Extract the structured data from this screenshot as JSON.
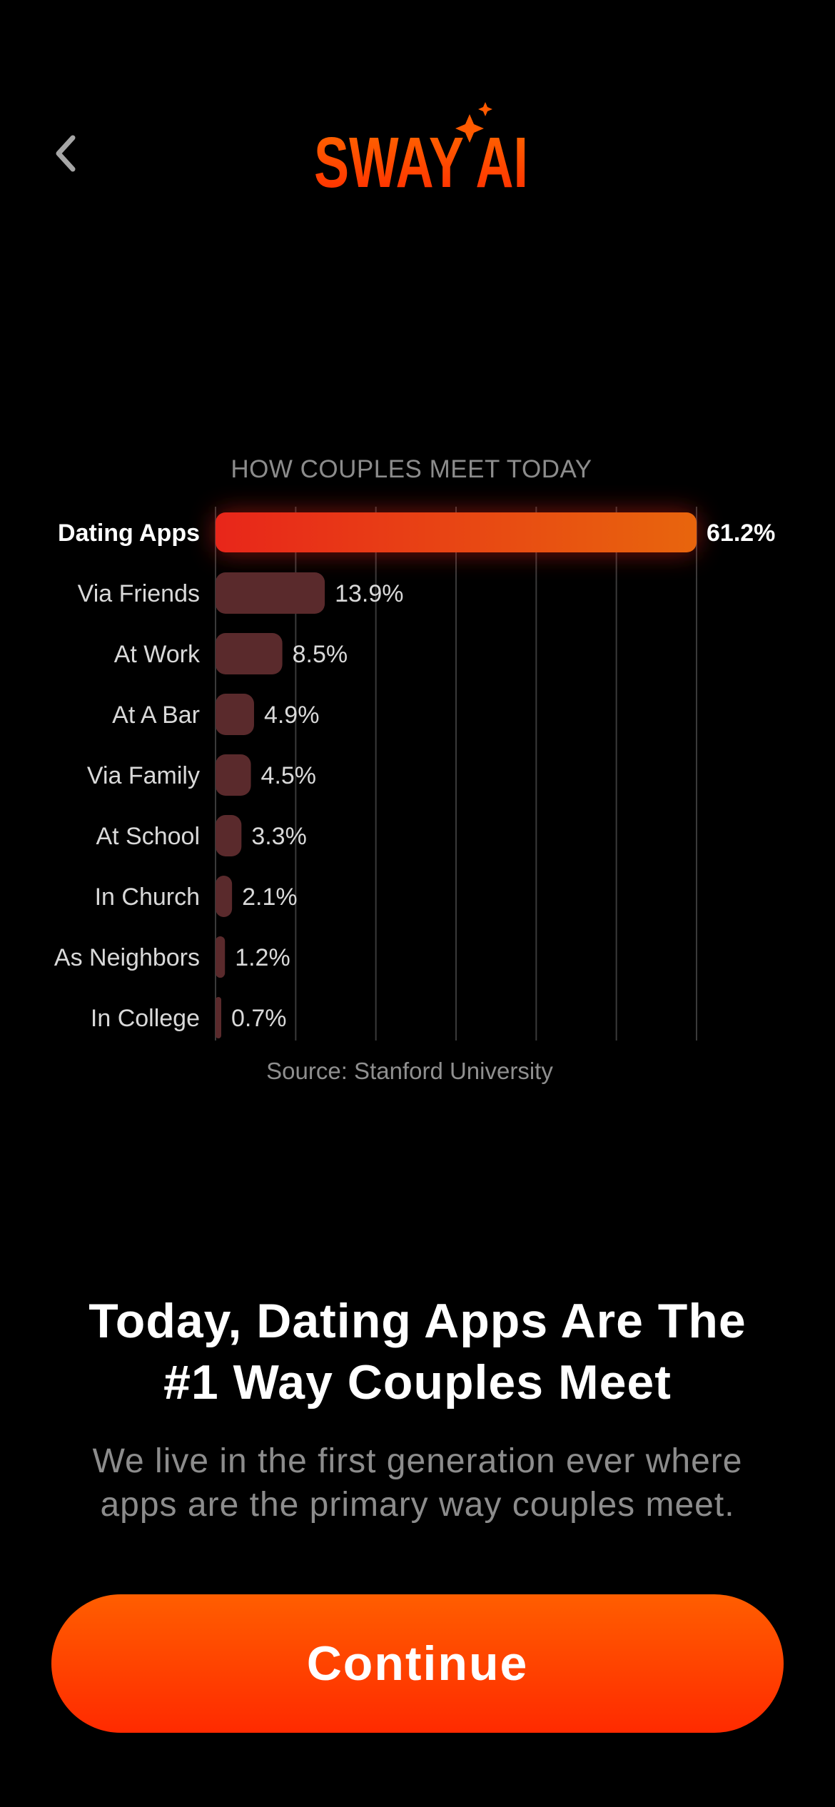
{
  "header": {
    "back_icon": "chevron-left-icon",
    "logo_text": "SWAY AI",
    "logo_icon": "sparkle-icon"
  },
  "chart_data": {
    "type": "bar",
    "orientation": "horizontal",
    "title": "HOW COUPLES MEET TODAY",
    "categories": [
      "Dating Apps",
      "Via Friends",
      "At Work",
      "At A Bar",
      "Via Family",
      "At School",
      "In Church",
      "As Neighbors",
      "In College"
    ],
    "values": [
      61.2,
      13.9,
      8.5,
      4.9,
      4.5,
      3.3,
      2.1,
      1.2,
      0.7
    ],
    "value_labels": [
      "61.2%",
      "13.9%",
      "8.5%",
      "4.9%",
      "4.5%",
      "3.3%",
      "2.1%",
      "1.2%",
      "0.7%"
    ],
    "highlight_index": 0,
    "xlim": [
      0,
      61.2
    ],
    "grid": true,
    "source": "Source: Stanford University",
    "colors": {
      "highlight_start": "#e8261a",
      "highlight_end": "#e8650d",
      "bar": "#5a2a2c",
      "grid": "#3a3a3a",
      "label": "#d9d9d9",
      "highlight_label": "#ffffff"
    }
  },
  "main": {
    "headline_line1": "Today, Dating Apps Are The",
    "headline_line2": "#1 Way Couples Meet",
    "subtext_line1": "We live in the first generation ever where",
    "subtext_line2": "apps are the primary way couples meet."
  },
  "cta": {
    "label": "Continue",
    "color_top": "#ff5e00",
    "color_bottom": "#ff2a00"
  }
}
